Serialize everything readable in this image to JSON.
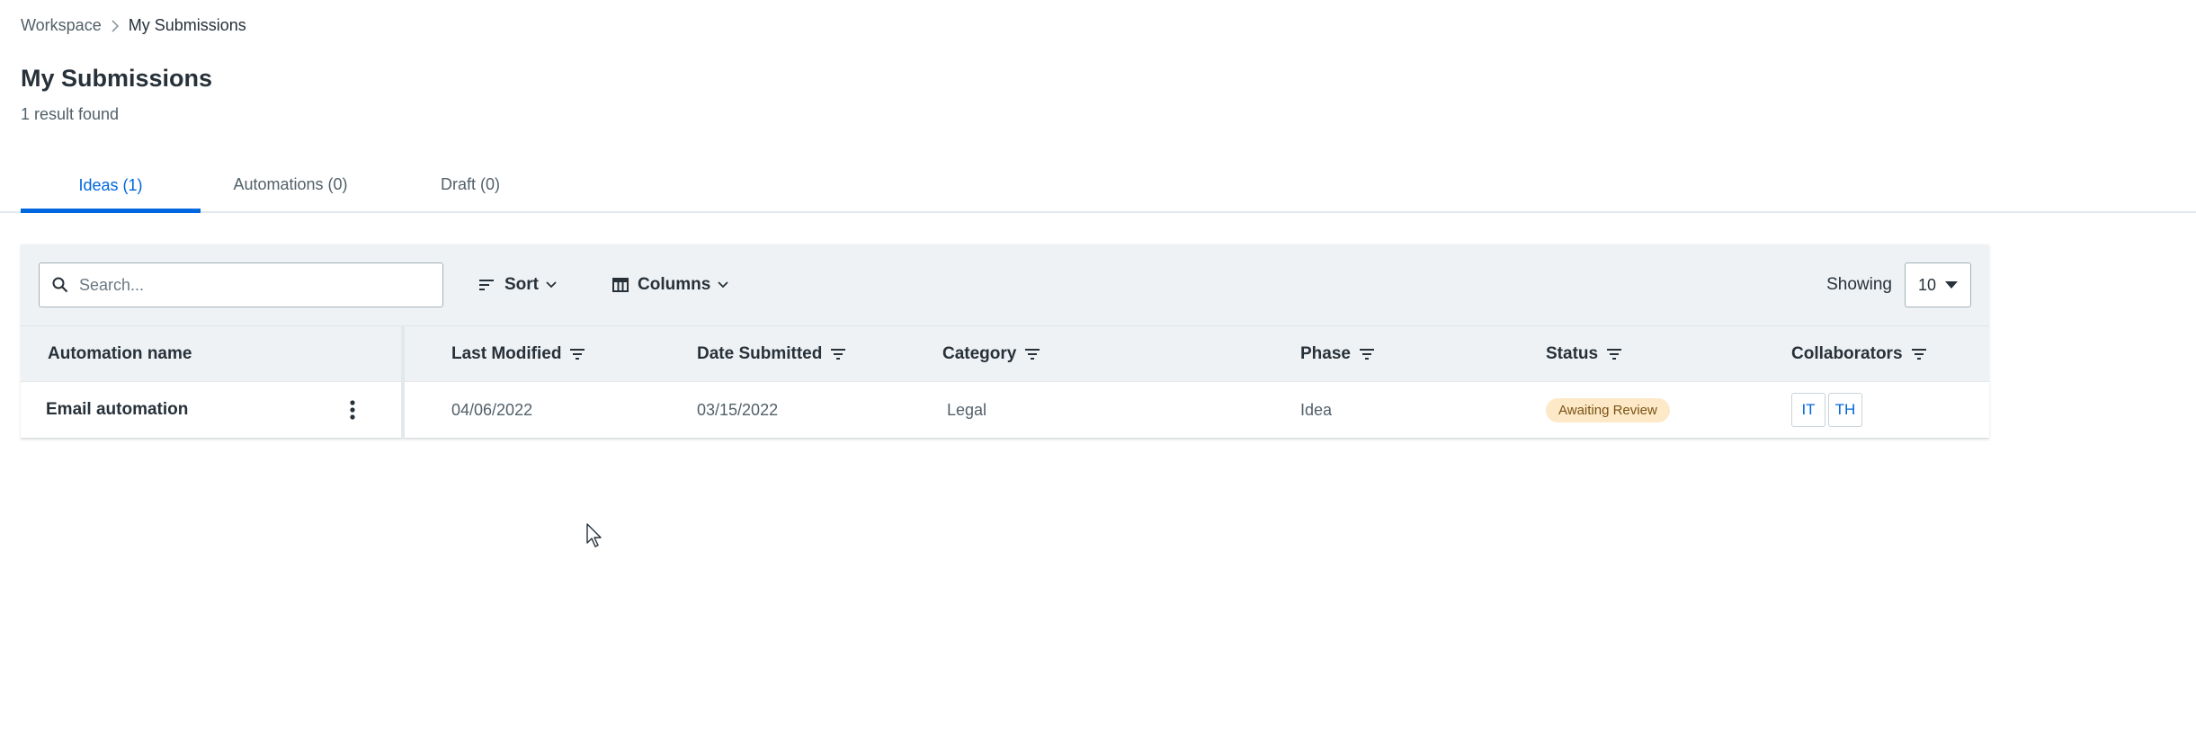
{
  "breadcrumb": {
    "parent": "Workspace",
    "current": "My Submissions"
  },
  "page": {
    "title": "My Submissions",
    "result_count": "1 result found"
  },
  "tabs": [
    {
      "label": "Ideas (1)",
      "active": true
    },
    {
      "label": "Automations (0)",
      "active": false
    },
    {
      "label": "Draft (0)",
      "active": false
    }
  ],
  "toolbar": {
    "search_placeholder": "Search...",
    "sort_label": "Sort",
    "columns_label": "Columns",
    "showing_label": "Showing",
    "page_size": "10"
  },
  "table": {
    "columns": [
      "Automation name",
      "Last Modified",
      "Date Submitted",
      "Category",
      "Phase",
      "Status",
      "Collaborators"
    ],
    "rows": [
      {
        "name": "Email automation",
        "last_modified": "04/06/2022",
        "date_submitted": "03/15/2022",
        "category": "Legal",
        "phase": "Idea",
        "status": "Awaiting Review",
        "collaborators": [
          "IT",
          "TH"
        ]
      }
    ]
  },
  "colors": {
    "accent": "#0067df",
    "status_badge_bg": "#fde9c8",
    "toolbar_bg": "#eef2f5"
  },
  "icons": [
    "chevron-right-icon",
    "search-icon",
    "sort-icon",
    "columns-icon",
    "chevron-down-icon",
    "filter-icon",
    "more-vertical-icon",
    "caret-down-icon",
    "mouse-cursor-icon"
  ]
}
